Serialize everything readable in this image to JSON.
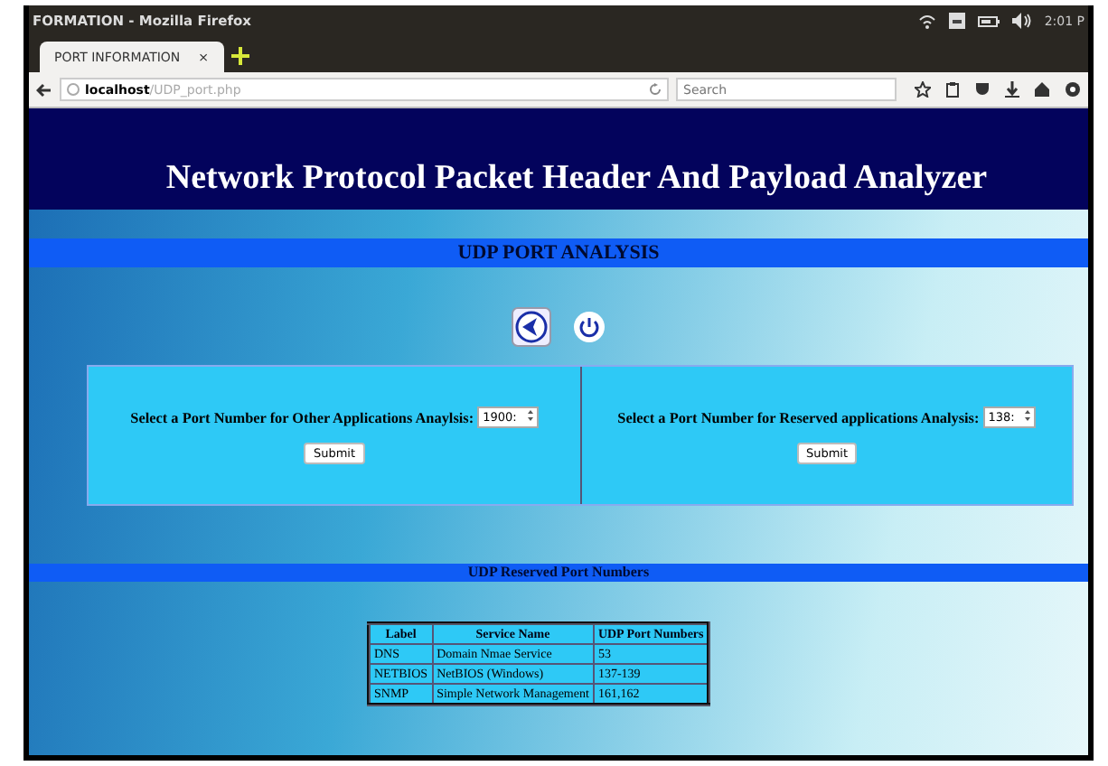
{
  "window": {
    "title": "FORMATION - Mozilla Firefox"
  },
  "system_tray": {
    "clock": "2:01 P"
  },
  "tabs": [
    {
      "label": "PORT INFORMATION",
      "close": "×",
      "selected": true
    }
  ],
  "address_bar": {
    "host": "localhost",
    "path": "/UDP_port.php"
  },
  "search": {
    "placeholder": "Search"
  },
  "page": {
    "title": "Network Protocol Packet Header And Payload Analyzer",
    "section_title": "UDP PORT ANALYSIS",
    "forms": [
      {
        "label": "Select a Port Number for Other Applications Anaylsis:",
        "value": "1900:",
        "button": "Submit"
      },
      {
        "label": "Select a Port Number for Reserved applications Analysis:",
        "value": "138:",
        "button": "Submit"
      }
    ],
    "reserved_title": "UDP Reserved Port Numbers",
    "table": {
      "columns": [
        "Label",
        "Service Name",
        "UDP Port Numbers"
      ],
      "rows": [
        [
          "DNS",
          "Domain Nmae Service",
          "53"
        ],
        [
          "NETBIOS",
          "NetBIOS (Windows)",
          "137-139"
        ],
        [
          "SNMP",
          "Simple Network Management",
          "161,162"
        ]
      ]
    }
  }
}
